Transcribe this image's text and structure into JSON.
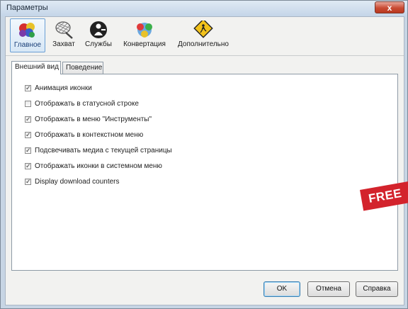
{
  "window": {
    "title": "Параметры",
    "close_glyph": "x"
  },
  "toolbar": {
    "items": [
      {
        "label": "Главное",
        "icon": "balloons-icon",
        "active": true
      },
      {
        "label": "Захват",
        "icon": "net-icon",
        "active": false
      },
      {
        "label": "Службы",
        "icon": "service-icon",
        "active": false
      },
      {
        "label": "Конвертация",
        "icon": "convert-icon",
        "active": false
      },
      {
        "label": "Дополнительно",
        "icon": "warning-sign-icon",
        "active": false
      }
    ]
  },
  "tabs": [
    {
      "label": "Внешний вид",
      "active": true
    },
    {
      "label": "Поведение",
      "active": false
    }
  ],
  "options": [
    {
      "label": "Анимация иконки",
      "checked": true
    },
    {
      "label": "Отображать в статусной строке",
      "checked": false
    },
    {
      "label": "Отображать в меню \"Инструменты\"",
      "checked": true
    },
    {
      "label": "Отображать в контекстном меню",
      "checked": true
    },
    {
      "label": "Подсвечивать медиа с текущей страницы",
      "checked": true
    },
    {
      "label": "Отображать иконки в системном меню",
      "checked": true
    },
    {
      "label": "Display download counters",
      "checked": true
    }
  ],
  "buttons": {
    "ok": "OK",
    "cancel": "Отмена",
    "help": "Справка"
  },
  "banner": {
    "text": "FREE"
  },
  "colors": {
    "accent": "#d3232c",
    "selection": "#d7e7f6"
  }
}
